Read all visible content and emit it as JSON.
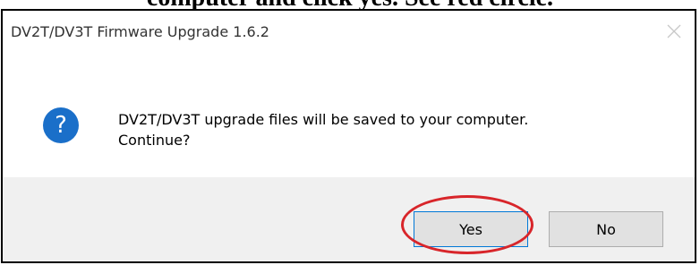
{
  "caption": "computer and click yes. See red circle.",
  "window": {
    "title": "DV2T/DV3T Firmware Upgrade 1.6.2",
    "close_icon": "close-icon"
  },
  "dialog": {
    "icon": "question-icon",
    "icon_glyph": "?",
    "message": "DV2T/DV3T upgrade files will be saved to your computer.\nContinue?"
  },
  "buttons": {
    "yes_label": "Yes",
    "no_label": "No"
  },
  "annotation": {
    "type": "red-circle",
    "color": "#d8252a",
    "target": "Yes"
  }
}
